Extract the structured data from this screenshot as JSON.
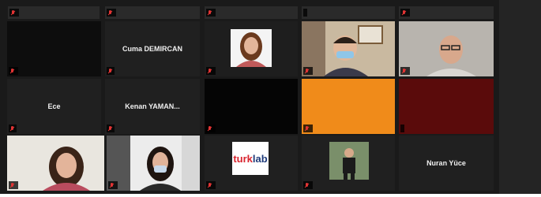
{
  "window": {
    "title": ""
  },
  "top_row_labels": [
    "",
    "",
    "",
    "",
    ""
  ],
  "participants": [
    {
      "id": "p1",
      "name": "",
      "display_label": "",
      "muted": true,
      "video": "dark"
    },
    {
      "id": "p2",
      "name": "Cuma DEMIRCAN",
      "display_label": "Cuma DEMIRCAN",
      "muted": true,
      "video": "none"
    },
    {
      "id": "p3",
      "name": "",
      "display_label": "",
      "muted": true,
      "video": "woman"
    },
    {
      "id": "p4",
      "name": "",
      "display_label": "",
      "muted": true,
      "video": "boy-mask"
    },
    {
      "id": "p5",
      "name": "",
      "display_label": "",
      "muted": true,
      "video": "man-glasses"
    },
    {
      "id": "p6",
      "name": "Ece",
      "display_label": "Ece",
      "muted": true,
      "video": "none"
    },
    {
      "id": "p7",
      "name": "Kenan YAMAN...",
      "display_label": "Kenan YAMAN...",
      "muted": true,
      "video": "none"
    },
    {
      "id": "p8",
      "name": "",
      "display_label": "",
      "muted": true,
      "video": "dark"
    },
    {
      "id": "p9",
      "name": "",
      "display_label": "",
      "muted": true,
      "video": "orange"
    },
    {
      "id": "p10",
      "name": "",
      "display_label": "",
      "muted": false,
      "video": "red"
    },
    {
      "id": "p11",
      "name": "",
      "display_label": "",
      "muted": true,
      "video": "woman-speaking",
      "active": true
    },
    {
      "id": "p12",
      "name": "",
      "display_label": "",
      "muted": true,
      "video": "girl-mask"
    },
    {
      "id": "p13",
      "name": "",
      "display_label": "",
      "muted": true,
      "video": "turklab"
    },
    {
      "id": "p14",
      "name": "",
      "display_label": "",
      "muted": true,
      "video": "man-standing"
    },
    {
      "id": "p15",
      "name": "Nuran Yüce",
      "display_label": "Nuran Yüce",
      "muted": true,
      "video": "none"
    }
  ],
  "logo": {
    "prefix": "turk",
    "suffix": "lab"
  },
  "colors": {
    "background": "#1a1a1a",
    "tile": "#202020",
    "active_speaker_border": "#c6e36c",
    "muted_icon": "#e23434",
    "orange_tile": "#f08b1a",
    "red_tile": "#5a0b0b"
  }
}
